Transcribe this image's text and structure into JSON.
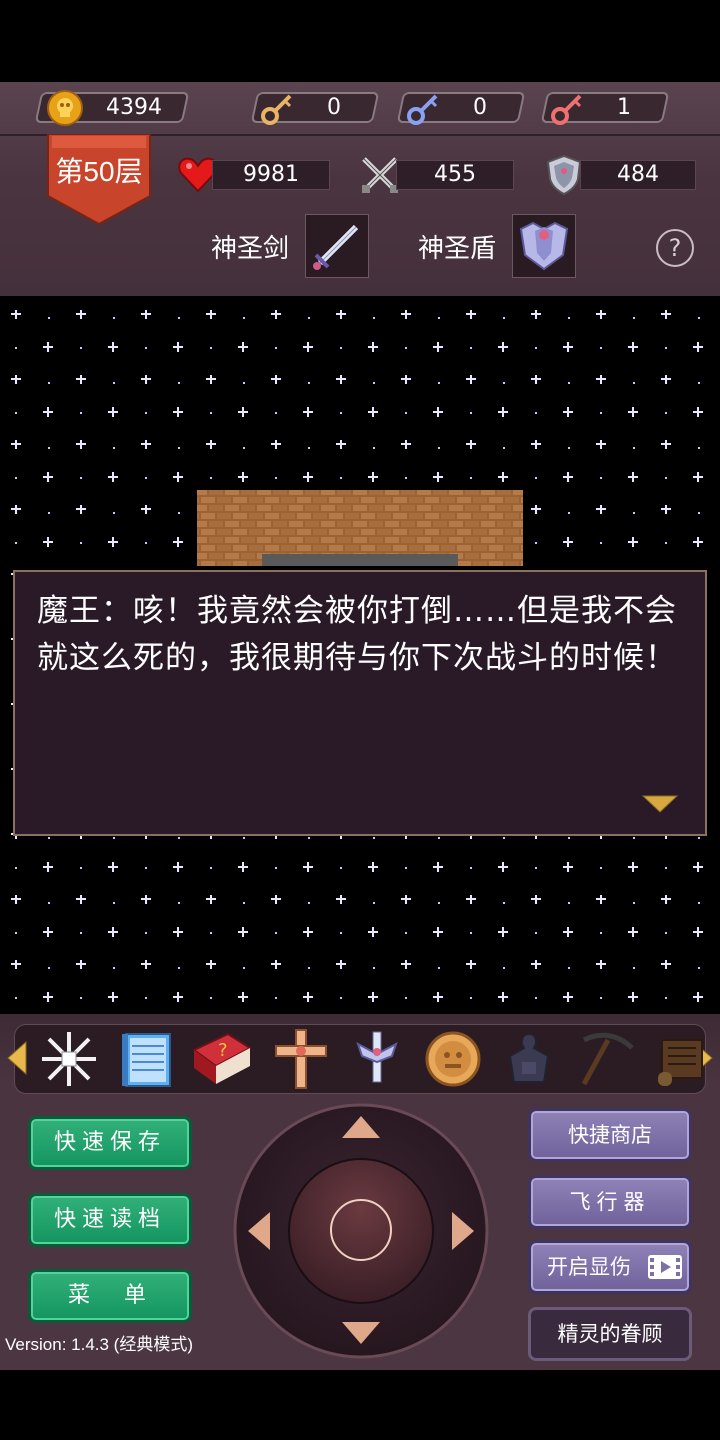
{
  "hud": {
    "gold": "4394",
    "yellow_keys": "0",
    "blue_keys": "0",
    "red_keys": "1",
    "floor": "第50层",
    "hp": "9981",
    "attack": "455",
    "defense": "484",
    "weapon": "神圣剑",
    "armor": "神圣盾",
    "help": "?"
  },
  "dialog": {
    "text": "魔王：咳！我竟然会被你打倒……但是我不会就这么死的，我很期待与你下次战斗的时候！"
  },
  "items": [
    "snowflake-icon",
    "notebook-icon",
    "monster-book-icon",
    "cross-icon",
    "holy-sword-icon",
    "coin-icon",
    "magic-key-icon",
    "pickaxe-icon",
    "scroll-icon"
  ],
  "buttons": {
    "quick_save": "快速保存",
    "quick_load": "快速读档",
    "menu": "菜　单",
    "quick_shop": "快捷商店",
    "flyer": "飞行器",
    "show_damage": "开启显伤",
    "fairy_favor": "精灵的眷顾"
  },
  "version": "Version: 1.4.3 (经典模式)",
  "colors": {
    "panel": "#4a3440",
    "dialog_bg": "#2a1a28",
    "green_button": "#1fa06a",
    "purple_button": "#7d70a8",
    "floor_banner": "#c8442b"
  }
}
